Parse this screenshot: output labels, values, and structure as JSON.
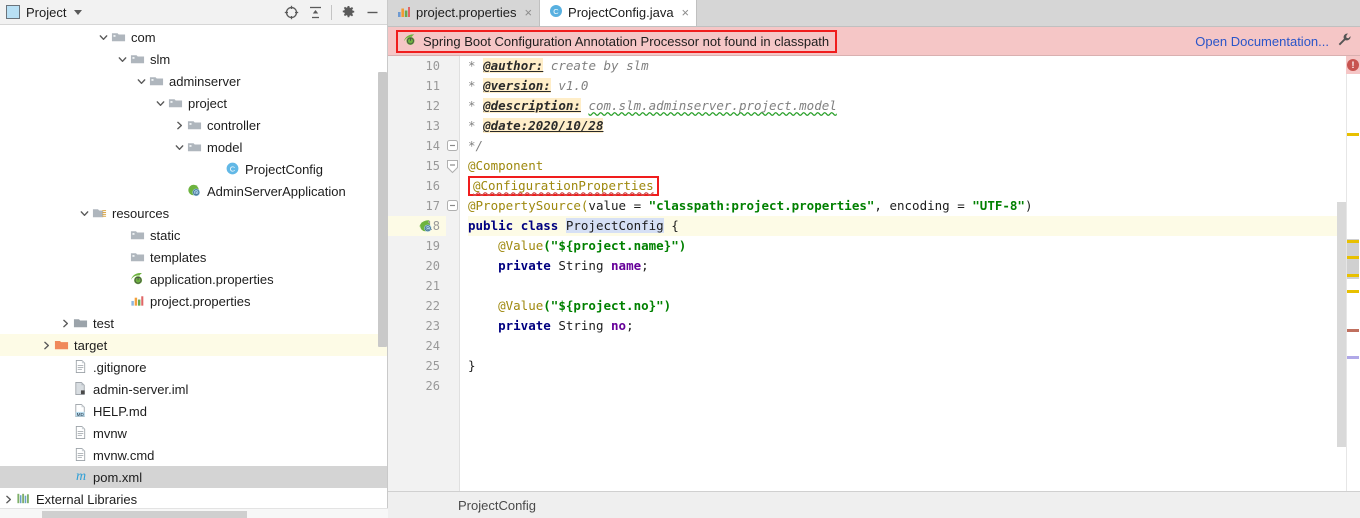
{
  "project_panel": {
    "title": "Project",
    "title_icon": "project-window-icon",
    "header_buttons": [
      {
        "name": "scroll-from-source-icon",
        "label": ""
      },
      {
        "name": "collapse-all-icon",
        "label": ""
      },
      {
        "name": "gear-icon",
        "label": ""
      },
      {
        "name": "hide-icon",
        "label": ""
      }
    ],
    "tree": [
      {
        "label": "com",
        "indent": 5,
        "arrow": "down",
        "icon": "package-icon",
        "state": "normal"
      },
      {
        "label": "slm",
        "indent": 6,
        "arrow": "down",
        "icon": "package-icon",
        "state": "normal"
      },
      {
        "label": "adminserver",
        "indent": 7,
        "arrow": "down",
        "icon": "package-icon",
        "state": "normal"
      },
      {
        "label": "project",
        "indent": 8,
        "arrow": "down",
        "icon": "package-icon",
        "state": "normal"
      },
      {
        "label": "controller",
        "indent": 9,
        "arrow": "right",
        "icon": "package-icon",
        "state": "normal"
      },
      {
        "label": "model",
        "indent": 9,
        "arrow": "down",
        "icon": "package-icon",
        "state": "normal"
      },
      {
        "label": "ProjectConfig",
        "indent": 11,
        "arrow": "none",
        "icon": "java-class-icon",
        "state": "normal"
      },
      {
        "label": "AdminServerApplication",
        "indent": 9,
        "arrow": "none",
        "icon": "spring-boot-class-icon",
        "state": "normal"
      },
      {
        "label": "resources",
        "indent": 4,
        "arrow": "down",
        "icon": "resources-folder-icon",
        "state": "normal"
      },
      {
        "label": "static",
        "indent": 6,
        "arrow": "none",
        "icon": "folder-icon",
        "state": "normal"
      },
      {
        "label": "templates",
        "indent": 6,
        "arrow": "none",
        "icon": "folder-icon",
        "state": "normal"
      },
      {
        "label": "application.properties",
        "indent": 6,
        "arrow": "none",
        "icon": "spring-properties-icon",
        "state": "normal"
      },
      {
        "label": "project.properties",
        "indent": 6,
        "arrow": "none",
        "icon": "properties-icon",
        "state": "normal"
      },
      {
        "label": "test",
        "indent": 3,
        "arrow": "right",
        "icon": "test-folder-icon",
        "state": "normal"
      },
      {
        "label": "target",
        "indent": 2,
        "arrow": "right",
        "icon": "target-folder-icon",
        "state": "highlight"
      },
      {
        "label": ".gitignore",
        "indent": 3,
        "arrow": "none",
        "icon": "file-icon",
        "state": "normal"
      },
      {
        "label": "admin-server.iml",
        "indent": 3,
        "arrow": "none",
        "icon": "iml-file-icon",
        "state": "normal"
      },
      {
        "label": "HELP.md",
        "indent": 3,
        "arrow": "none",
        "icon": "markdown-file-icon",
        "state": "normal"
      },
      {
        "label": "mvnw",
        "indent": 3,
        "arrow": "none",
        "icon": "file-icon",
        "state": "normal"
      },
      {
        "label": "mvnw.cmd",
        "indent": 3,
        "arrow": "none",
        "icon": "file-icon",
        "state": "normal"
      },
      {
        "label": "pom.xml",
        "indent": 3,
        "arrow": "none",
        "icon": "maven-file-icon",
        "state": "selected"
      },
      {
        "label": "External Libraries",
        "indent": 0,
        "arrow": "right",
        "icon": "libraries-icon",
        "state": "normal"
      }
    ]
  },
  "editor": {
    "tabs": [
      {
        "label": "project.properties",
        "icon": "properties-icon",
        "active": false,
        "close": "×"
      },
      {
        "label": "ProjectConfig.java",
        "icon": "java-class-icon",
        "active": true,
        "close": "×"
      }
    ],
    "notification": {
      "text": "Spring Boot Configuration Annotation Processor not found in classpath",
      "icon": "spring-boot-icon",
      "link": "Open Documentation...",
      "action_icon": "wrench-icon",
      "background": "#f5c6c6",
      "outline_color": "#f01d1d"
    },
    "line_numbers": [
      10,
      11,
      12,
      13,
      14,
      15,
      16,
      17,
      18,
      19,
      20,
      21,
      22,
      23,
      24,
      25,
      26
    ],
    "current_line": 18,
    "lines": {
      "l10_star": "*",
      "l10_tag": "@author:",
      "l10_val": "create by slm",
      "l11_star": "*",
      "l11_tag": "@version:",
      "l11_val": "v1.0",
      "l12_star": "*",
      "l12_tag": "@description:",
      "l12_val": "com.slm.adminserver.project.model",
      "l13_star": "*",
      "l13_tag": "@date:2020/10/28",
      "l14": "*/",
      "l15": "@Component",
      "l16": "@ConfigurationProperties",
      "l17_a": "@PropertySource(",
      "l17_b": "value",
      "l17_c": " = ",
      "l17_d": "\"classpath:project.properties\"",
      "l17_e": ", encoding = ",
      "l17_f": "\"UTF-8\"",
      "l17_g": ")",
      "l18_kw1": "public",
      "l18_kw2": "class",
      "l18_name": "ProjectConfig",
      "l18_brace": "{",
      "l19_anno": "@Value",
      "l19_str": "(\"${project.name}\")",
      "l20_kw": "private",
      "l20_type": "String",
      "l20_field": "name",
      "l20_semi": ";",
      "l22_anno": "@Value",
      "l22_str": "(\"${project.no}\")",
      "l23_kw": "private",
      "l23_type": "String",
      "l23_field": "no",
      "l23_semi": ";",
      "l25": "}"
    },
    "error_badge": "!",
    "breadcrumb": "ProjectConfig"
  },
  "colors": {
    "notification_bg": "#f5c6c6",
    "highlight_box": "#f01d1d",
    "current_line": "#fdfbe6",
    "keyword": "#000080",
    "string": "#008000",
    "annotation": "#9e880d",
    "field": "#660099",
    "link": "#2a55c9"
  }
}
